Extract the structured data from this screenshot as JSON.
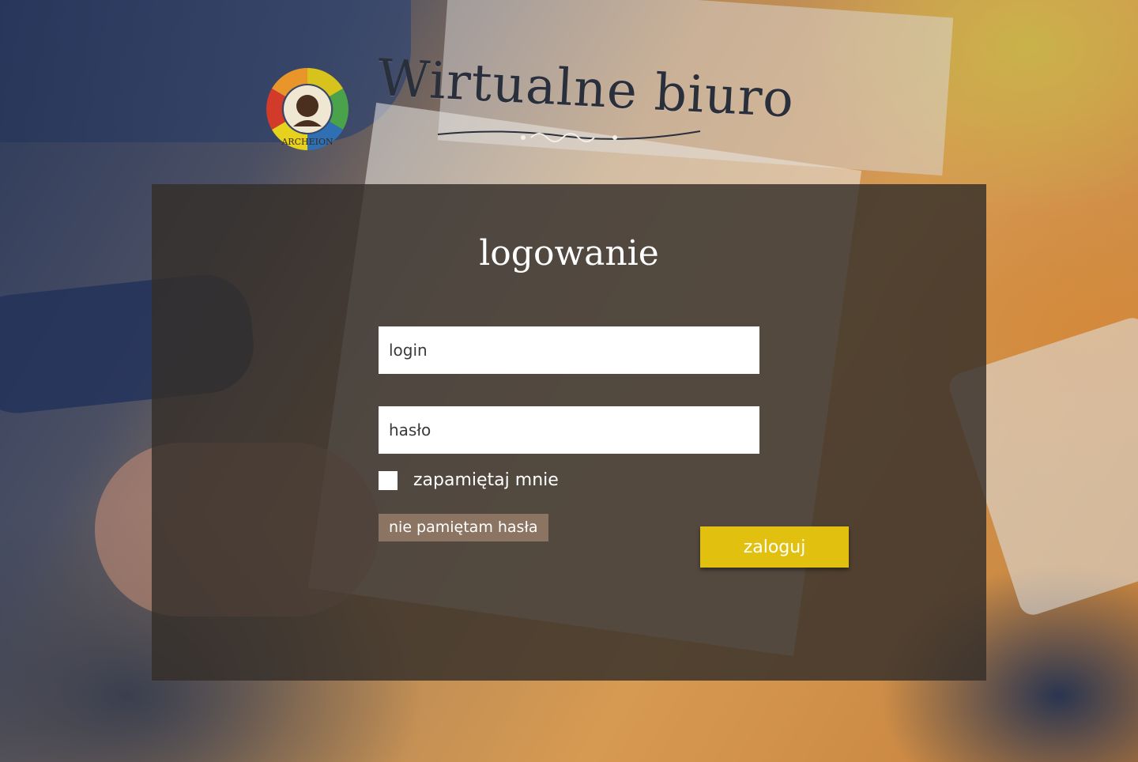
{
  "header": {
    "title": "Wirtualne biuro",
    "logo_text": "ARCHEION"
  },
  "login": {
    "heading": "logowanie",
    "login_placeholder": "login",
    "password_placeholder": "hasło",
    "remember_label": "zapamiętaj mnie",
    "forgot_label": "nie pamiętam hasła",
    "submit_label": "zaloguj"
  },
  "colors": {
    "panel_bg": "#342e2a",
    "forgot_bg": "#8c7463",
    "submit_bg": "#e2c00f"
  }
}
